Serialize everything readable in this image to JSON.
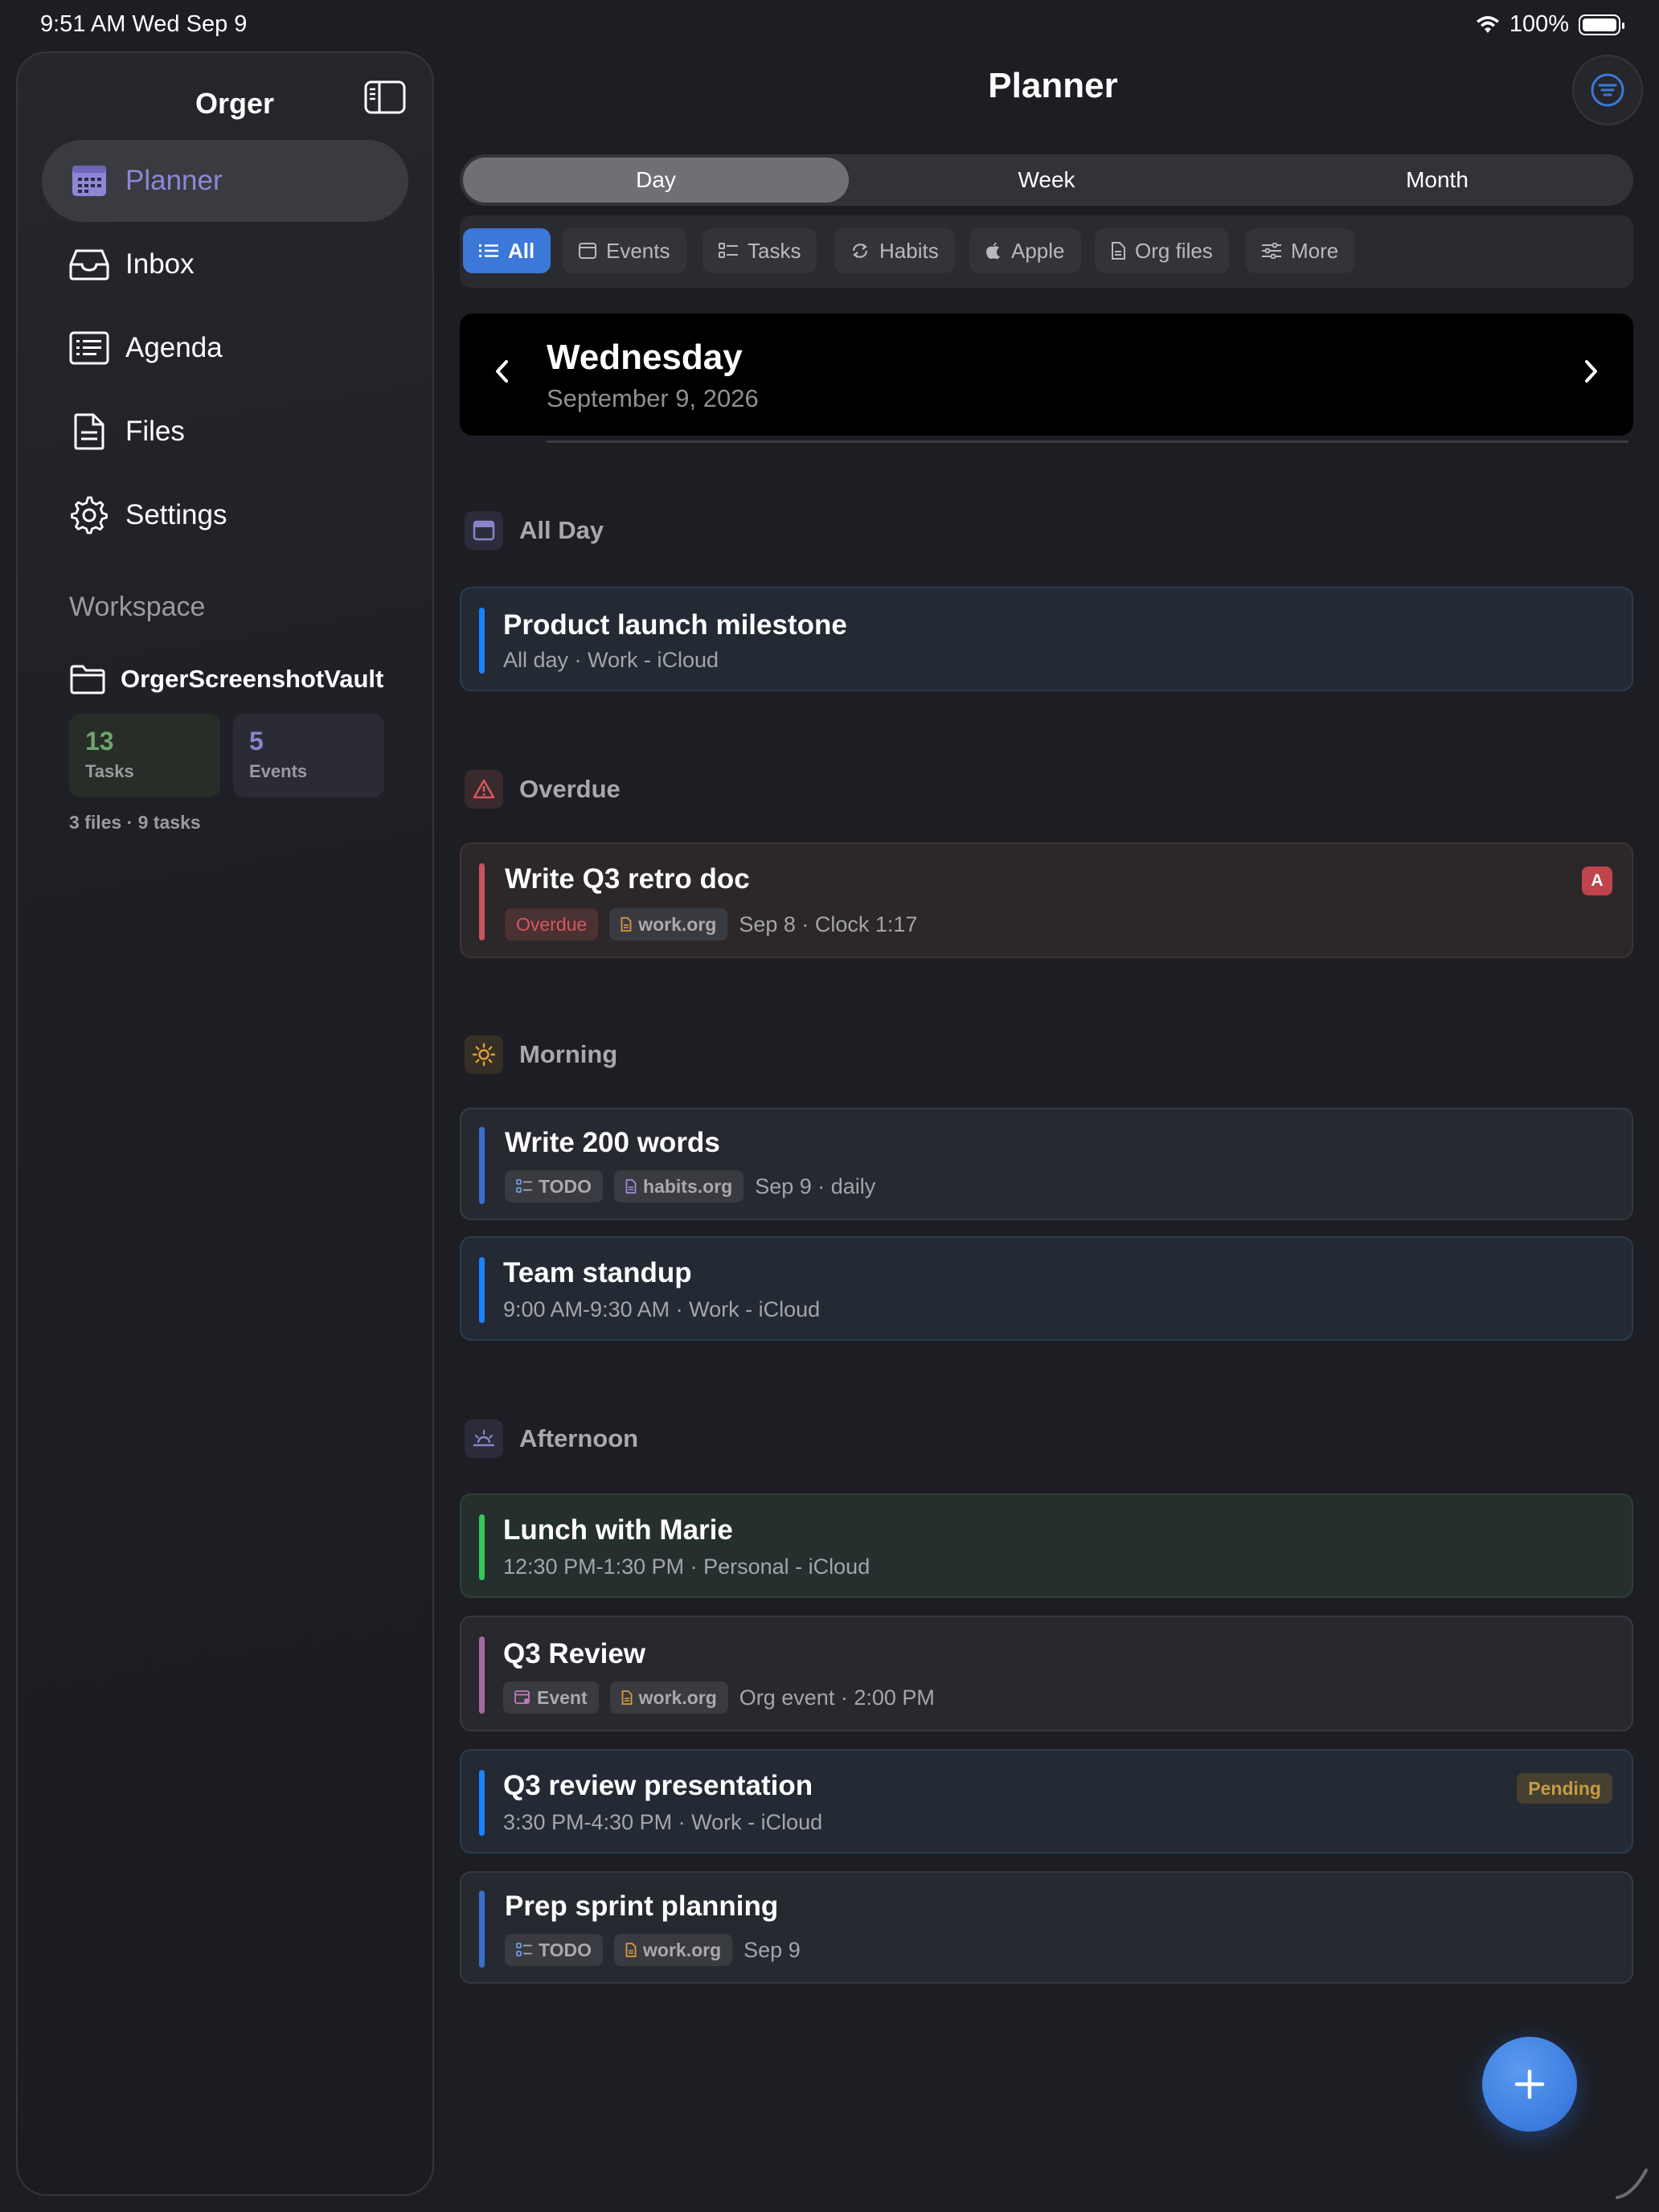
{
  "status_bar": {
    "time": "9:51 AM   Wed Sep 9",
    "battery": "100%"
  },
  "sidebar": {
    "title": "Orger",
    "nav": [
      {
        "label": "Planner",
        "icon": "calendar-grid-icon",
        "active": true
      },
      {
        "label": "Inbox",
        "icon": "inbox-tray-icon"
      },
      {
        "label": "Agenda",
        "icon": "agenda-list-icon"
      },
      {
        "label": "Files",
        "icon": "document-icon"
      },
      {
        "label": "Settings",
        "icon": "gear-icon"
      }
    ],
    "workspace_label": "Workspace",
    "vault_name": "OrgerScreenshotVault",
    "stats": {
      "tasks_count": "13",
      "tasks_label": "Tasks",
      "events_count": "5",
      "events_label": "Events"
    },
    "footer": "3 files · 9 tasks"
  },
  "main": {
    "title": "Planner",
    "segments": [
      "Day",
      "Week",
      "Month"
    ],
    "active_segment": "Day",
    "chips": [
      "All",
      "Events",
      "Tasks",
      "Habits",
      "Apple",
      "Org files",
      "More"
    ],
    "active_chip": "All",
    "date": {
      "weekday": "Wednesday",
      "full": "September 9, 2026"
    },
    "sections": {
      "all_day": "All Day",
      "overdue": "Overdue",
      "morning": "Morning",
      "afternoon": "Afternoon"
    },
    "cards": {
      "product_launch": {
        "title": "Product launch milestone",
        "sub": "All day · Work - iCloud"
      },
      "retro_doc": {
        "title": "Write Q3 retro doc",
        "status": "Overdue",
        "file": "work.org",
        "meta": "Sep 8 · Clock 1:17",
        "priority": "A"
      },
      "write_words": {
        "title": "Write 200 words",
        "state": "TODO",
        "file": "habits.org",
        "meta": "Sep 9 · daily"
      },
      "standup": {
        "title": "Team standup",
        "sub": "9:00 AM-9:30 AM · Work - iCloud"
      },
      "lunch": {
        "title": "Lunch with Marie",
        "sub": "12:30 PM-1:30 PM · Personal - iCloud"
      },
      "q3_review": {
        "title": "Q3 Review",
        "kind": "Event",
        "file": "work.org",
        "meta": "Org event · 2:00 PM"
      },
      "presentation": {
        "title": "Q3 review presentation",
        "sub": "3:30 PM-4:30 PM · Work - iCloud",
        "badge": "Pending"
      },
      "sprint": {
        "title": "Prep sprint planning",
        "state": "TODO",
        "file": "work.org",
        "meta": "Sep 9"
      }
    }
  },
  "colors": {
    "accent_blue": "#3c78d8",
    "planner_purple": "#8f86d7",
    "calendar_blue": "#1a84ff",
    "personal_green": "#34c759",
    "overdue_red": "#c8555c",
    "org_purple": "#a26ba0"
  }
}
